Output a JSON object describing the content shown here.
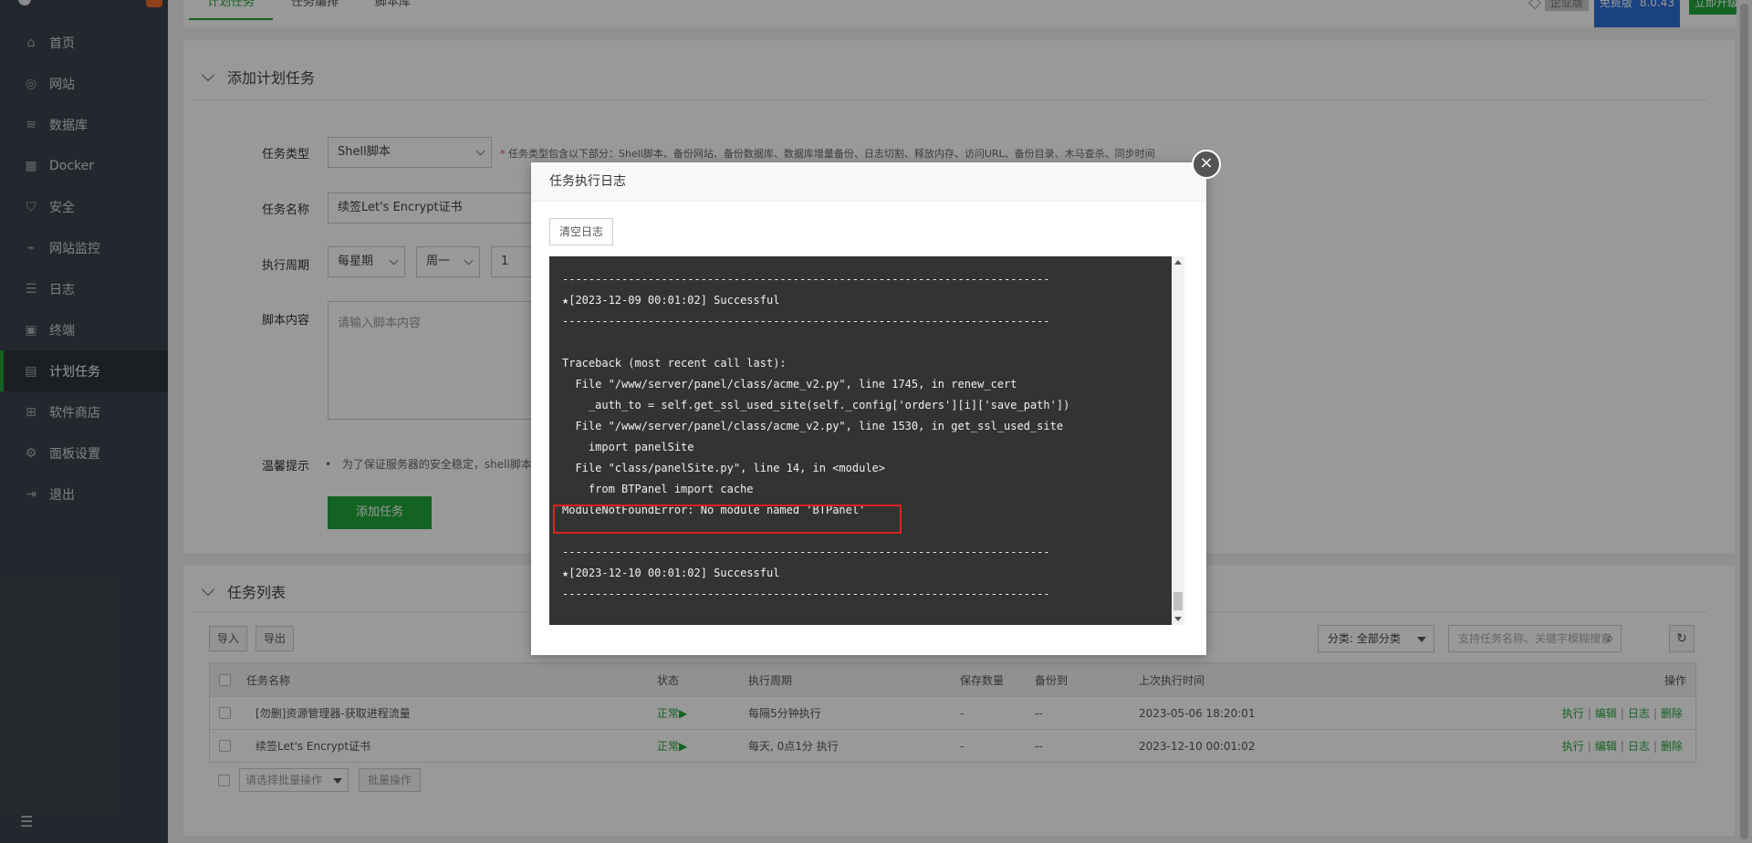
{
  "sidebar": {
    "items": [
      {
        "label": "首页",
        "icon": "home-icon",
        "glyph": "⌂"
      },
      {
        "label": "网站",
        "icon": "globe-icon",
        "glyph": "◎"
      },
      {
        "label": "数据库",
        "icon": "database-icon",
        "glyph": "≋"
      },
      {
        "label": "Docker",
        "icon": "docker-icon",
        "glyph": "▦"
      },
      {
        "label": "安全",
        "icon": "shield-icon",
        "glyph": "⛉"
      },
      {
        "label": "网站监控",
        "icon": "chart-icon",
        "glyph": "⌁"
      },
      {
        "label": "日志",
        "icon": "log-icon",
        "glyph": "☰"
      },
      {
        "label": "终端",
        "icon": "terminal-icon",
        "glyph": "▣"
      },
      {
        "label": "计划任务",
        "icon": "calendar-icon",
        "glyph": "▤",
        "active": true
      },
      {
        "label": "软件商店",
        "icon": "apps-icon",
        "glyph": "⊞"
      },
      {
        "label": "面板设置",
        "icon": "gear-icon",
        "glyph": "⚙"
      },
      {
        "label": "退出",
        "icon": "logout-icon",
        "glyph": "⇥"
      }
    ],
    "collapse_glyph": "☰"
  },
  "topbar": {
    "tabs": [
      "计划任务",
      "任务编排",
      "脚本库"
    ],
    "enterprise": "企业版",
    "free": "免费版",
    "version": "8.0.43",
    "upgrade": "立即升级"
  },
  "add_task": {
    "title": "添加计划任务",
    "type_label": "任务类型",
    "type_value": "Shell脚本",
    "type_hint_star": "*",
    "type_hint": "任务类型包含以下部分：Shell脚本、备份网站、备份数据库、数据库增量备份、日志切割、释放内存、访问URL、备份目录、木马查杀、同步时间",
    "name_label": "任务名称",
    "name_value": "续签Let's Encrypt证书",
    "cycle_label": "执行周期",
    "cycle_type": "每星期",
    "cycle_week": "周一",
    "cycle_num": "1",
    "script_label": "脚本内容",
    "script_placeholder": "请输入脚本内容",
    "tips_label": "温馨提示",
    "tips_bullet": "•",
    "tips_text": "为了保证服务器的安全稳定，shell脚本",
    "submit": "添加任务"
  },
  "task_list": {
    "title": "任务列表",
    "import": "导入",
    "export": "导出",
    "category": "分类: 全部分类",
    "search_placeholder": "支持任务名称、关键字模糊搜索",
    "columns": {
      "name": "任务名称",
      "status": "状态",
      "cycle": "执行周期",
      "keep": "保存数量",
      "backup": "备份到",
      "last_run": "上次执行时间",
      "ops": "操作"
    },
    "rows": [
      {
        "name": "[勿删]资源管理器-获取进程流量",
        "status": "正常▶",
        "cycle": "每隔5分钟执行",
        "keep": "-",
        "backup": "--",
        "last_run": "2023-05-06 18:20:01"
      },
      {
        "name": "续签Let's Encrypt证书",
        "status": "正常▶",
        "cycle": "每天, 0点1分 执行",
        "keep": "-",
        "backup": "--",
        "last_run": "2023-12-10 00:01:02"
      }
    ],
    "op_labels": {
      "run": "执行",
      "edit": "编辑",
      "log": "日志",
      "delete": "删除",
      "sep": "|"
    },
    "batch_select": "请选择批量操作",
    "batch_button": "批量操作"
  },
  "modal": {
    "title": "任务执行日志",
    "close": "×",
    "clear_log": "清空日志",
    "log_lines": [
      "--------------------------------------------------------------------------",
      "★[2023-12-09 00:01:02] Successful",
      "--------------------------------------------------------------------------",
      "",
      "Traceback (most recent call last):",
      "  File \"/www/server/panel/class/acme_v2.py\", line 1745, in renew_cert",
      "    _auth_to = self.get_ssl_used_site(self._config['orders'][i]['save_path'])",
      "  File \"/www/server/panel/class/acme_v2.py\", line 1530, in get_ssl_used_site",
      "    import panelSite",
      "  File \"class/panelSite.py\", line 14, in <module>",
      "    from BTPanel import cache",
      "ModuleNotFoundError: No module named 'BTPanel'",
      "",
      "--------------------------------------------------------------------------",
      "★[2023-12-10 00:01:02] Successful",
      "--------------------------------------------------------------------------"
    ]
  },
  "colors": {
    "accent": "#20a53a",
    "sidebar": "#3c444d",
    "highlight": "#e02020",
    "pro": "#2a6fd6"
  }
}
